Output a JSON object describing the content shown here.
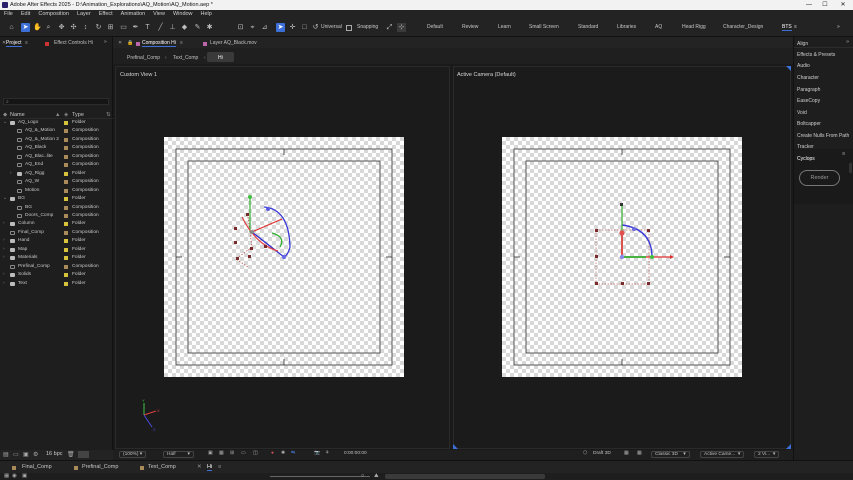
{
  "window": {
    "title": "Adobe After Effects 2025 - D:\\Animation_Explorations\\AQ_Motion\\AQ_Motion.aep *",
    "controls": [
      "—",
      "☐",
      "✕"
    ]
  },
  "menu": [
    "File",
    "Edit",
    "Composition",
    "Layer",
    "Effect",
    "Animation",
    "View",
    "Window",
    "Help"
  ],
  "toolbar": {
    "universal_label": "Universal",
    "snapping_label": "Snapping",
    "workspaces": [
      "Default",
      "Review",
      "Learn",
      "Small Screen",
      "Standard",
      "Libraries",
      "AQ",
      "Head Rigg",
      "Character_Design",
      "BTS"
    ],
    "active_workspace": "BTS"
  },
  "project_panel": {
    "tabs": [
      "Project",
      "Effect Controls Hi"
    ],
    "search_placeholder": "",
    "columns": {
      "name": "Name",
      "type": "Type"
    },
    "rows": [
      {
        "name": "AQ_Logo",
        "type": "Folder",
        "level": 0,
        "kind": "folder",
        "expanded": true,
        "color": "#d6c33b"
      },
      {
        "name": "AQ_&_Motion",
        "type": "Composition",
        "level": 1,
        "kind": "comp",
        "color": "#a98a5a"
      },
      {
        "name": "AQ_&_Motion 2",
        "type": "Composition",
        "level": 1,
        "kind": "comp",
        "color": "#a98a5a"
      },
      {
        "name": "AQ_Black",
        "type": "Composition",
        "level": 1,
        "kind": "comp",
        "color": "#a98a5a"
      },
      {
        "name": "AQ_Blac..lite",
        "type": "Composition",
        "level": 1,
        "kind": "comp",
        "color": "#a98a5a"
      },
      {
        "name": "AQ_End",
        "type": "Composition",
        "level": 1,
        "kind": "comp",
        "color": "#a98a5a"
      },
      {
        "name": "AQ_Rigg",
        "type": "Folder",
        "level": 1,
        "kind": "folder",
        "expanded": false,
        "color": "#d6c33b"
      },
      {
        "name": "AQ_W",
        "type": "Composition",
        "level": 1,
        "kind": "comp",
        "color": "#a98a5a"
      },
      {
        "name": "Motion",
        "type": "Composition",
        "level": 1,
        "kind": "comp",
        "color": "#a98a5a"
      },
      {
        "name": "BG",
        "type": "Folder",
        "level": 0,
        "kind": "folder",
        "expanded": true,
        "color": "#d6c33b"
      },
      {
        "name": "BG",
        "type": "Composition",
        "level": 1,
        "kind": "comp",
        "color": "#a98a5a"
      },
      {
        "name": "Doors_Comp",
        "type": "Composition",
        "level": 1,
        "kind": "comp",
        "color": "#a98a5a"
      },
      {
        "name": "Column",
        "type": "Folder",
        "level": 0,
        "kind": "folder",
        "expanded": false,
        "color": "#d6c33b"
      },
      {
        "name": "Final_Comp",
        "type": "Composition",
        "level": 0,
        "kind": "comp",
        "color": "#a98a5a"
      },
      {
        "name": "Hand",
        "type": "Folder",
        "level": 0,
        "kind": "folder",
        "expanded": false,
        "color": "#d6c33b"
      },
      {
        "name": "Map",
        "type": "Folder",
        "level": 0,
        "kind": "folder",
        "expanded": false,
        "color": "#d6c33b"
      },
      {
        "name": "Materials",
        "type": "Folder",
        "level": 0,
        "kind": "folder",
        "expanded": false,
        "color": "#d6c33b"
      },
      {
        "name": "Prefinal_Comp",
        "type": "Composition",
        "level": 0,
        "kind": "comp",
        "color": "#a98a5a"
      },
      {
        "name": "Solids",
        "type": "Folder",
        "level": 0,
        "kind": "folder",
        "expanded": false,
        "color": "#d6c33b"
      },
      {
        "name": "Text",
        "type": "Folder",
        "level": 0,
        "kind": "folder",
        "expanded": false,
        "color": "#d6c33b"
      }
    ],
    "bpc": "16 bpc"
  },
  "composition_panel": {
    "tabs": [
      "Composition Hi",
      "Layer AQ_Black.mov"
    ],
    "breadcrumbs": [
      "Prefinal_Comp",
      "Text_Comp",
      "Hi"
    ],
    "left_view_label": "Custom View 1",
    "right_view_label": "Active Camera (Default)",
    "zoom": "(100%)",
    "resolution": "Half",
    "timecode": "0:00:00:00",
    "renderer": "Draft 3D",
    "renderer_mode": "Classic 3D",
    "camera": "Active Came...",
    "views": "2 Vi..."
  },
  "right_panel": {
    "items": [
      "Align",
      "Effects & Presets",
      "Audio",
      "Character",
      "Paragraph",
      "EaseCopy",
      "Void",
      "Boltcapper",
      "Create Nulls From Path",
      "Tracker",
      "Cyclops"
    ],
    "render_button": "Render"
  },
  "timeline_tabs": [
    "Final_Comp",
    "Prefinal_Comp",
    "Text_Comp",
    "Hi"
  ],
  "colors": {
    "accent": "#3c6fd8",
    "folder_label": "#d6c33b",
    "comp_label": "#a98a5a"
  }
}
